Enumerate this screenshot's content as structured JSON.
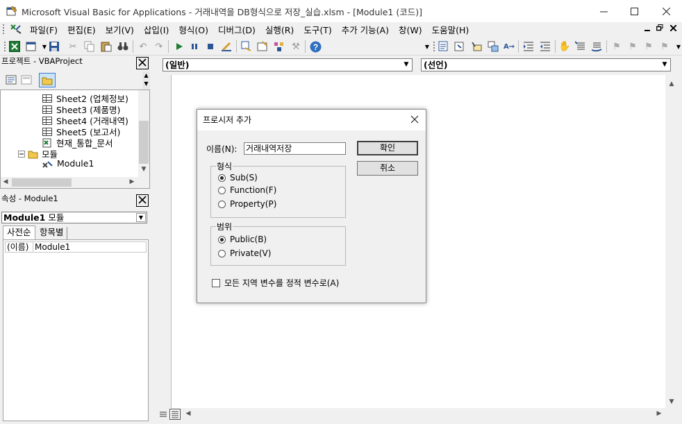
{
  "window": {
    "title": "Microsoft Visual Basic for Applications - 거래내역을 DB형식으로 저장_실습.xlsm - [Module1 (코드)]"
  },
  "menu": {
    "items": [
      "파일(F)",
      "편집(E)",
      "보기(V)",
      "삽입(I)",
      "형식(O)",
      "디버그(D)",
      "실행(R)",
      "도구(T)",
      "추가 기능(A)",
      "창(W)",
      "도움말(H)"
    ]
  },
  "project_panel": {
    "title": "프로젝트 - VBAProject",
    "tree": [
      "Sheet2 (업체정보)",
      "Sheet3 (제품명)",
      "Sheet4 (거래내역)",
      "Sheet5 (보고서)",
      "현재_통합_문서",
      "모듈",
      "Module1"
    ]
  },
  "properties_panel": {
    "title": "속성 - Module1",
    "object_name": "Module1",
    "object_type": "모듈",
    "tabs": [
      "사전순",
      "항목별"
    ],
    "row_name": "(이름)",
    "row_value": "Module1"
  },
  "code_window": {
    "object_combo": "(일반)",
    "proc_combo": "(선언)"
  },
  "dialog": {
    "title": "프로시저 추가",
    "name_label": "이름(N):",
    "name_value": "거래내역저장",
    "ok_label": "확인",
    "cancel_label": "취소",
    "type_group": "형식",
    "type_options": [
      "Sub(S)",
      "Function(F)",
      "Property(P)"
    ],
    "type_selected": "Sub(S)",
    "scope_group": "범위",
    "scope_options": [
      "Public(B)",
      "Private(V)"
    ],
    "scope_selected": "Public(B)",
    "static_label": "모든 지역 변수를 정적 변수로(A)"
  },
  "colors": {
    "accent_green": "#1e7d32",
    "help_blue": "#2f6fbf"
  }
}
